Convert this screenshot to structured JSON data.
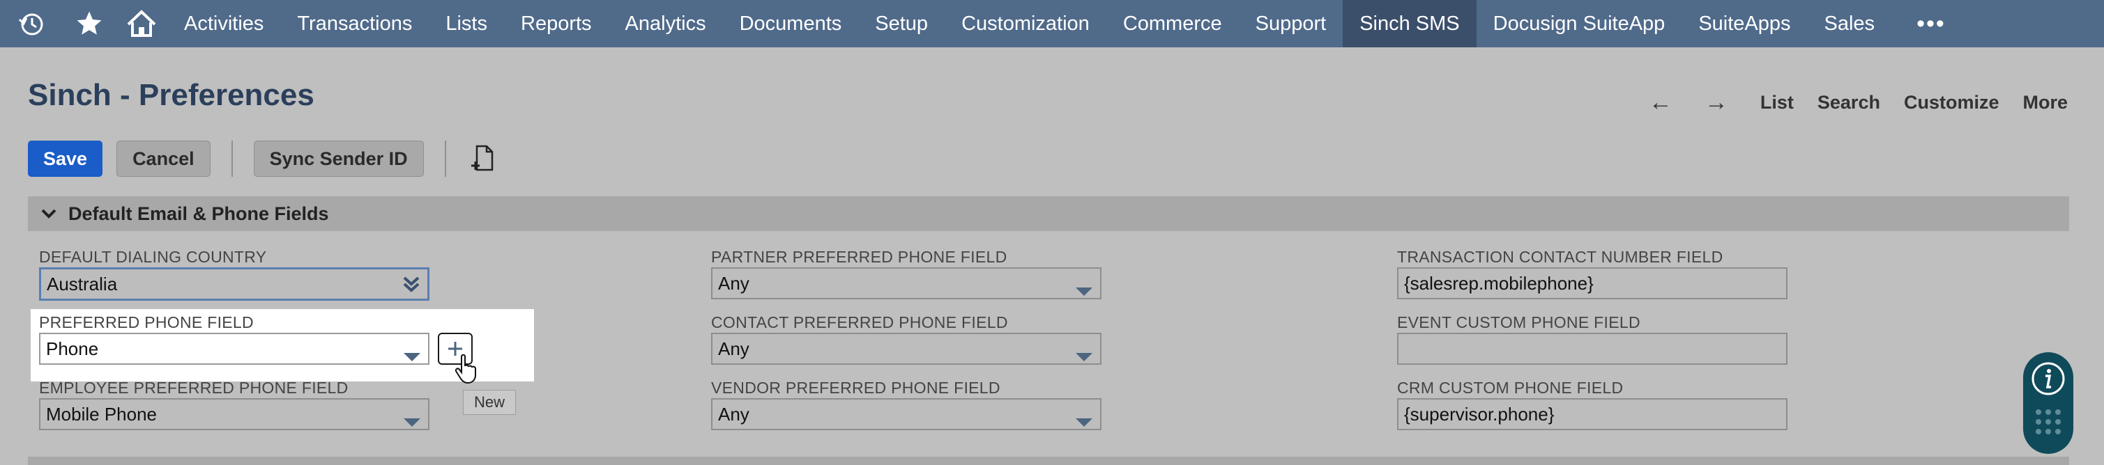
{
  "nav": {
    "items": [
      "Activities",
      "Transactions",
      "Lists",
      "Reports",
      "Analytics",
      "Documents",
      "Setup",
      "Customization",
      "Commerce",
      "Support",
      "Sinch SMS",
      "Docusign SuiteApp",
      "SuiteApps",
      "Sales"
    ],
    "active": "Sinch SMS",
    "more": "•••",
    "icons": [
      "recent-history-icon",
      "star-icon",
      "home-icon"
    ]
  },
  "page": {
    "title": "Sinch - Preferences"
  },
  "header_links": {
    "list": "List",
    "search": "Search",
    "customize": "Customize",
    "more": "More"
  },
  "toolbar": {
    "save": "Save",
    "cancel": "Cancel",
    "sync": "Sync Sender ID"
  },
  "section": {
    "title": "Default Email & Phone Fields"
  },
  "fields": {
    "default_dialing_country": {
      "label": "DEFAULT DIALING COUNTRY",
      "value": "Australia"
    },
    "preferred_phone": {
      "label": "PREFERRED PHONE FIELD",
      "value": "Phone"
    },
    "employee_phone": {
      "label": "EMPLOYEE PREFERRED PHONE FIELD",
      "value": "Mobile Phone"
    },
    "partner_phone": {
      "label": "PARTNER PREFERRED PHONE FIELD",
      "value": "Any"
    },
    "contact_phone": {
      "label": "CONTACT PREFERRED PHONE FIELD",
      "value": "Any"
    },
    "vendor_phone": {
      "label": "VENDOR PREFERRED PHONE FIELD",
      "value": "Any"
    },
    "transaction_contact": {
      "label": "TRANSACTION CONTACT NUMBER FIELD",
      "value": "{salesrep.mobilephone}"
    },
    "event_custom": {
      "label": "EVENT CUSTOM PHONE FIELD",
      "value": ""
    },
    "crm_custom": {
      "label": "CRM CUSTOM PHONE FIELD",
      "value": "{supervisor.phone}"
    }
  },
  "tooltip": {
    "text": "New"
  },
  "colors": {
    "nav_bg": "#506a8a",
    "nav_active": "#3b4f6b",
    "primary": "#1a5cc8",
    "title": "#2b3f5c",
    "help": "#0f4a5a"
  }
}
